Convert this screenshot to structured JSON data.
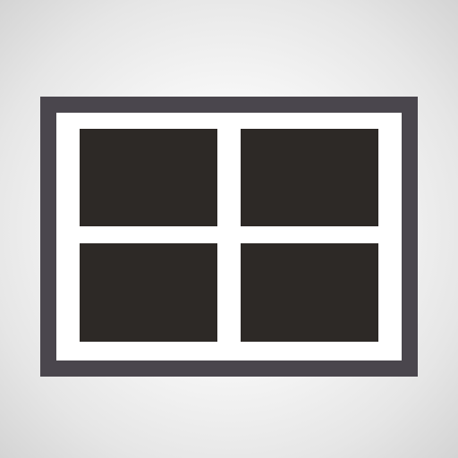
{
  "icon": {
    "name": "window-frame-icon",
    "pane_count": 4
  },
  "colors": {
    "frame": "#4a464d",
    "pane": "#2d2926",
    "mullion": "#ffffff",
    "background_center": "#ffffff",
    "background_edge": "#d4d4d4"
  }
}
